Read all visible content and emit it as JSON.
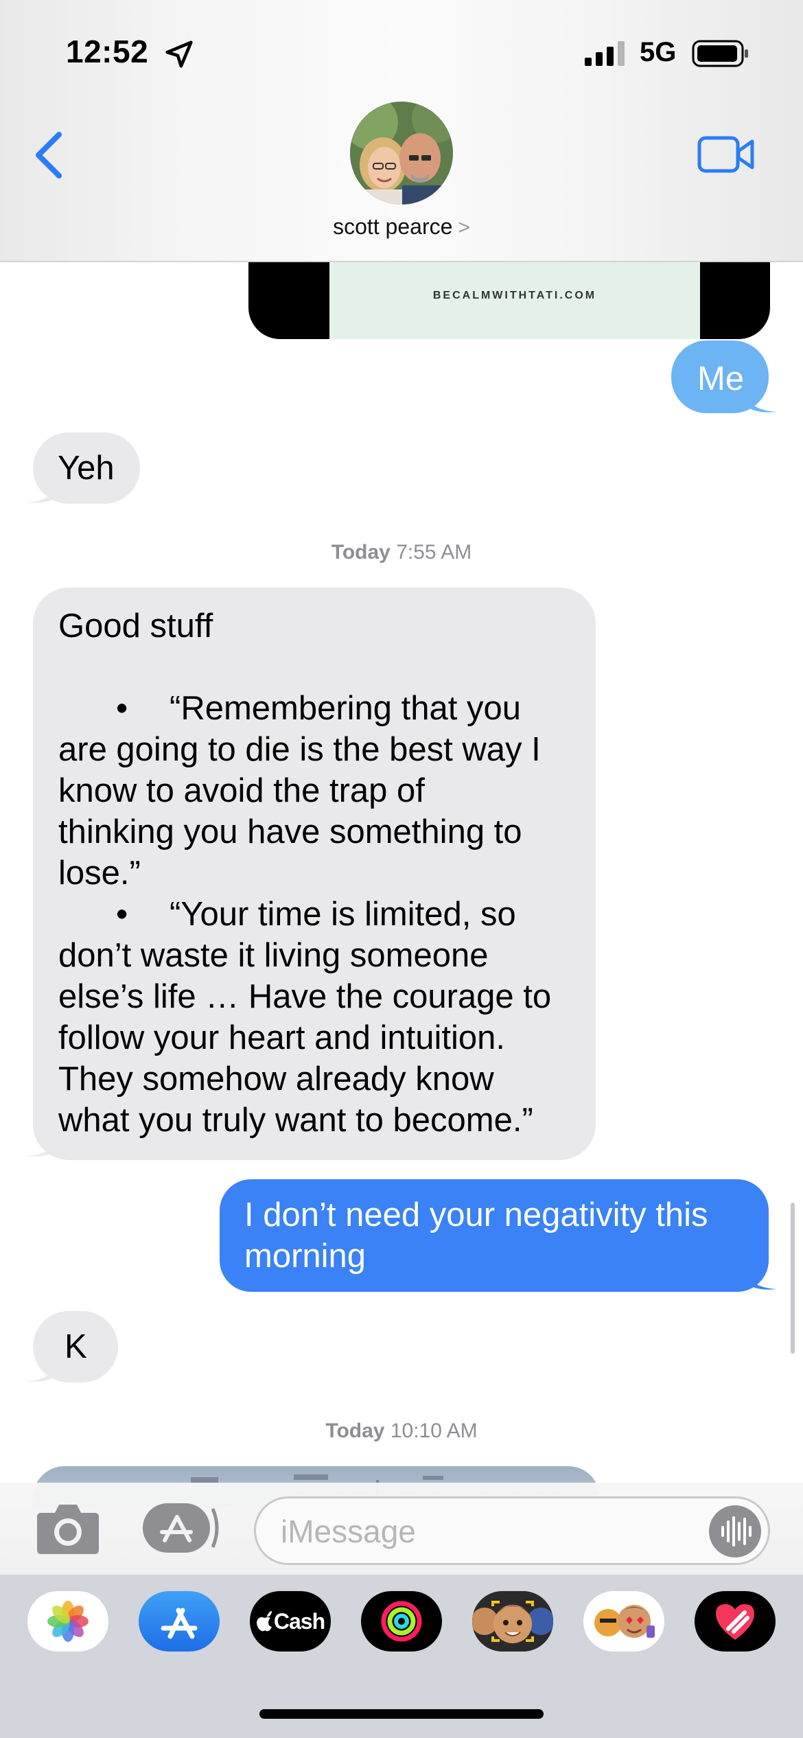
{
  "status_bar": {
    "time": "12:52",
    "network": "5G"
  },
  "header": {
    "contact_name": "scott pearce",
    "chevron": ">"
  },
  "link_preview": {
    "domain": "BECALMWITHTATI.COM"
  },
  "messages": {
    "me_reply": "Me",
    "yeh": "Yeh",
    "good_stuff_title": "Good stuff",
    "quote1_line1": "“Remembering that you",
    "quote1_line2": "are going to die is the best way I",
    "quote1_line3": "know to avoid the trap of",
    "quote1_line4": "thinking you have something to",
    "quote1_line5": "lose.”",
    "quote2_line1": "“Your time is limited, so",
    "quote2_line2": "don’t waste it living someone",
    "quote2_line3": "else’s life … Have the courage to",
    "quote2_line4": "follow your heart and intuition.",
    "quote2_line5": "They somehow already know",
    "quote2_line6": "what you truly want to become.”",
    "bullet": "•",
    "negativity_line1": "I don’t need your negativity this",
    "negativity_line2": "morning",
    "k": "K"
  },
  "timestamps": {
    "t1_day": "Today",
    "t1_time": "7:55 AM",
    "t2_day": "Today",
    "t2_time": "10:10 AM"
  },
  "input": {
    "placeholder": "iMessage"
  },
  "app_drawer": {
    "cash_label": "Cash",
    "apps": [
      "photos-app",
      "app-store-app",
      "apple-cash-app",
      "activity-app",
      "memoji-stickers-app",
      "animoji-app",
      "digital-touch-app"
    ]
  },
  "colors": {
    "accent": "#3a82f6",
    "outgoing_bubble": "#3a82f6",
    "incoming_bubble": "#e9e9eb"
  }
}
